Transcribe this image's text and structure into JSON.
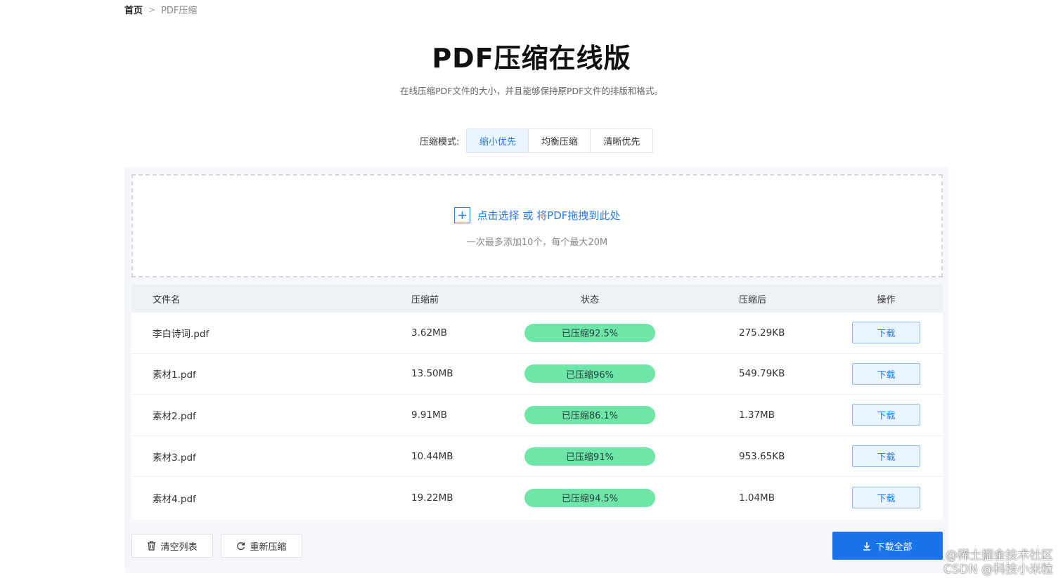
{
  "breadcrumb": {
    "home": "首页",
    "separator": ">",
    "current": "PDF压缩"
  },
  "header": {
    "title": "PDF压缩在线版",
    "subtitle": "在线压缩PDF文件的大小，并且能够保持原PDF文件的排版和格式。"
  },
  "mode": {
    "label": "压缩模式:",
    "options": [
      "缩小优先",
      "均衡压缩",
      "清晰优先"
    ],
    "selected": "缩小优先"
  },
  "dropzone": {
    "main_text": "点击选择 或 将PDF拖拽到此处",
    "sub_text": "一次最多添加10个，每个最大20M"
  },
  "table": {
    "headers": {
      "name": "文件名",
      "before": "压缩前",
      "status": "状态",
      "after": "压缩后",
      "operation": "操作"
    },
    "rows": [
      {
        "name": "李白诗词.pdf",
        "before": "3.62MB",
        "status": "已压缩92.5%",
        "after": "275.29KB",
        "action": "下载"
      },
      {
        "name": "素材1.pdf",
        "before": "13.50MB",
        "status": "已压缩96%",
        "after": "549.79KB",
        "action": "下载"
      },
      {
        "name": "素材2.pdf",
        "before": "9.91MB",
        "status": "已压缩86.1%",
        "after": "1.37MB",
        "action": "下载"
      },
      {
        "name": "素材3.pdf",
        "before": "10.44MB",
        "status": "已压缩91%",
        "after": "953.65KB",
        "action": "下载"
      },
      {
        "name": "素材4.pdf",
        "before": "19.22MB",
        "status": "已压缩94.5%",
        "after": "1.04MB",
        "action": "下载"
      }
    ]
  },
  "footer": {
    "clear_label": "清空列表",
    "recompress_label": "重新压缩",
    "download_all_label": "下载全部"
  },
  "watermark": {
    "line1": "@稀土掘金技术社区",
    "line2": "CSDN @科技小米粒"
  },
  "colors": {
    "accent": "#1a73e8",
    "status_green": "#6de6a8",
    "selected_bg": "#e9f4ff"
  }
}
